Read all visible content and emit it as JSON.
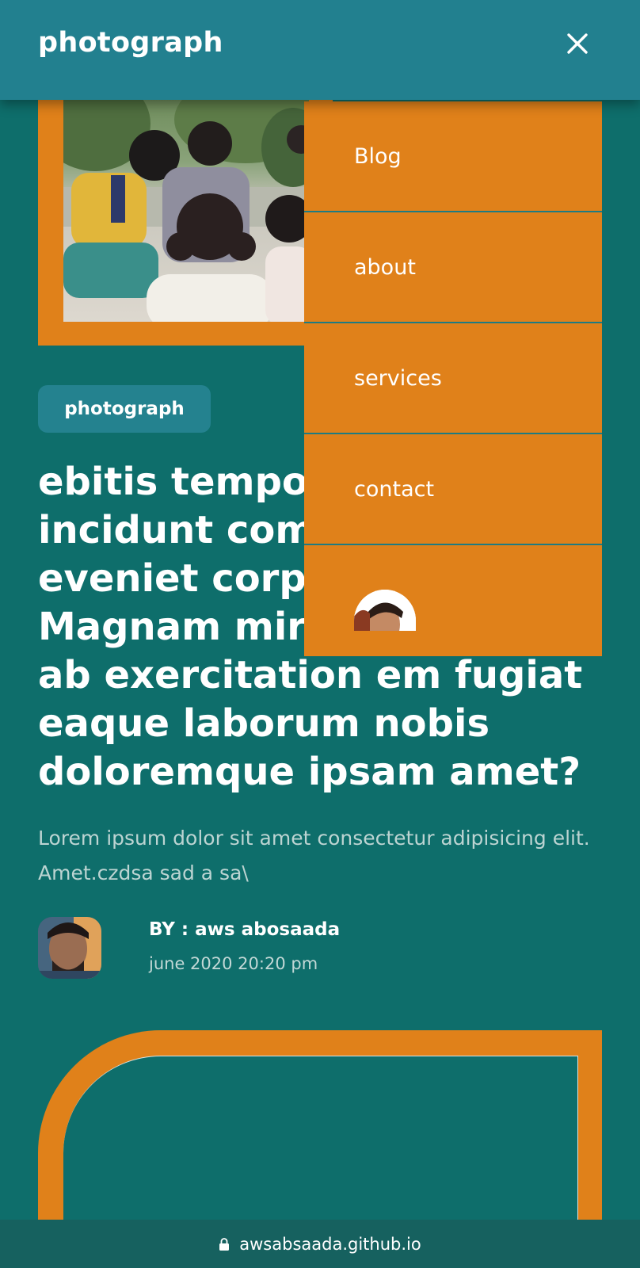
{
  "header": {
    "brand": "photograph",
    "close_icon": "close-icon"
  },
  "nav": {
    "items": [
      {
        "label": "Blog"
      },
      {
        "label": "about"
      },
      {
        "label": "services"
      },
      {
        "label": "contact"
      }
    ],
    "profile_icon": "avatar"
  },
  "post": {
    "category": "photograph",
    "title": "ebitis tempo incidunt com eveniet corp Magnam mir ab exercitation em fugiat eaque laborum nobis doloremque ipsam amet?",
    "title_lines": [
      "ebitis tempo",
      "incidunt com",
      "eveniet corp",
      "Magnam mir",
      "ab exercitation em fugiat",
      "eaque laborum nobis",
      "doloremque ipsam amet?"
    ],
    "excerpt": "Lorem ipsum dolor sit amet consectetur adipisicing elit. Amet.czdsa sad a sa\\",
    "author": "BY : aws abosaada",
    "date": "june 2020 20:20 pm"
  },
  "browser": {
    "url": "awsabsaada.github.io",
    "lock_icon": "lock-icon"
  },
  "colors": {
    "background": "#0e6e6b",
    "header": "#22808f",
    "accent": "#e0811a",
    "badge": "#24828f"
  }
}
